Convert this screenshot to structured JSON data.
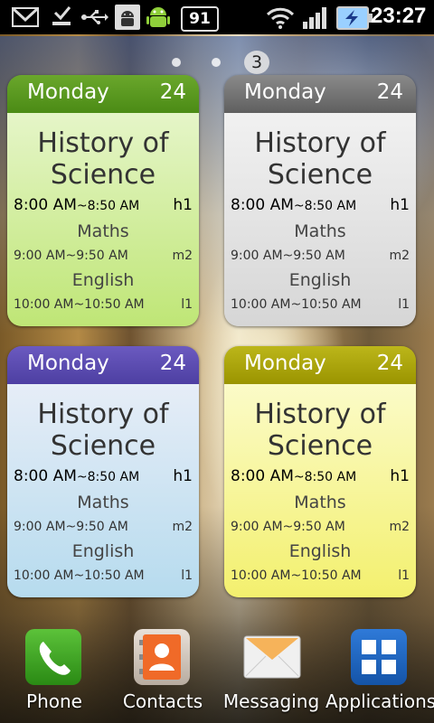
{
  "status_bar": {
    "icons": [
      "gmail-icon",
      "missed-download-icon",
      "usb-icon",
      "android-debug-icon",
      "android-mascot-icon",
      "wifi-icon",
      "signal-icon",
      "battery-charging-icon"
    ],
    "battery_percent": "91",
    "time": "23:27"
  },
  "home": {
    "page_indicator": "3"
  },
  "widgets": [
    {
      "color": "green",
      "day": "Monday",
      "date": "24",
      "title_line1": "History of",
      "title_line2": "Science",
      "first_time": "8:00 AM",
      "first_end": "~8:50 AM",
      "first_room": "h1",
      "second_subject": "Maths",
      "second_time": "9:00 AM~9:50 AM",
      "second_room": "m2",
      "third_subject": "English",
      "third_time": "10:00 AM~10:50 AM",
      "third_room": "l1"
    },
    {
      "color": "gray",
      "day": "Monday",
      "date": "24",
      "title_line1": "History of",
      "title_line2": "Science",
      "first_time": "8:00 AM",
      "first_end": "~8:50 AM",
      "first_room": "h1",
      "second_subject": "Maths",
      "second_time": "9:00 AM~9:50 AM",
      "second_room": "m2",
      "third_subject": "English",
      "third_time": "10:00 AM~10:50 AM",
      "third_room": "l1"
    },
    {
      "color": "blue",
      "day": "Monday",
      "date": "24",
      "title_line1": "History of",
      "title_line2": "Science",
      "first_time": "8:00 AM",
      "first_end": "~8:50 AM",
      "first_room": "h1",
      "second_subject": "Maths",
      "second_time": "9:00 AM~9:50 AM",
      "second_room": "m2",
      "third_subject": "English",
      "third_time": "10:00 AM~10:50 AM",
      "third_room": "l1"
    },
    {
      "color": "yellow",
      "day": "Monday",
      "date": "24",
      "title_line1": "History of",
      "title_line2": "Science",
      "first_time": "8:00 AM",
      "first_end": "~8:50 AM",
      "first_room": "h1",
      "second_subject": "Maths",
      "second_time": "9:00 AM~9:50 AM",
      "second_room": "m2",
      "third_subject": "English",
      "third_time": "10:00 AM~10:50 AM",
      "third_room": "l1"
    }
  ],
  "dock": [
    {
      "label": "Phone",
      "icon": "phone-icon"
    },
    {
      "label": "Contacts",
      "icon": "contacts-icon"
    },
    {
      "label": "Messaging",
      "icon": "messaging-icon"
    },
    {
      "label": "Applications",
      "icon": "applications-icon"
    }
  ]
}
